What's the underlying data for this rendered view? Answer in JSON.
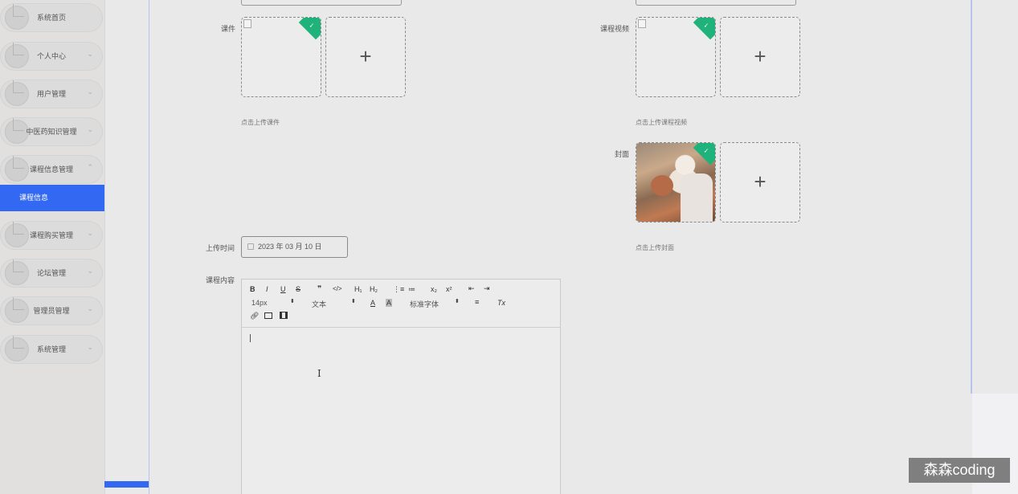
{
  "sidebar": {
    "items": [
      {
        "label": "系统首页",
        "has_arrow": false
      },
      {
        "label": "个人中心",
        "has_arrow": true
      },
      {
        "label": "用户管理",
        "has_arrow": true
      },
      {
        "label": "中医药知识管理",
        "has_arrow": true
      },
      {
        "label": "课程信息管理",
        "has_arrow": true,
        "expanded": true
      },
      {
        "label": "课程购买管理",
        "has_arrow": true
      },
      {
        "label": "论坛管理",
        "has_arrow": true
      },
      {
        "label": "管理员管理",
        "has_arrow": true
      },
      {
        "label": "系统管理",
        "has_arrow": true
      }
    ],
    "active_sub": "课程信息",
    "accent_color": "#3369f2"
  },
  "form": {
    "courseware": {
      "label": "课件",
      "hint": "点击上传课件"
    },
    "video": {
      "label": "课程视频",
      "hint": "点击上传课程视频"
    },
    "cover": {
      "label": "封面",
      "hint": "点击上传封面"
    },
    "upload_time": {
      "label": "上传时间",
      "value": "2023 年 03 月 10 日"
    },
    "content": {
      "label": "课程内容"
    },
    "add_glyph": "+"
  },
  "editor": {
    "toolbar": {
      "bold": "B",
      "italic": "I",
      "underline": "U",
      "strike": "S",
      "quote": "❞",
      "code": "</>",
      "h1": "H₁",
      "h2": "H₂",
      "ordered_list": "⋮≡",
      "bullet_list": "≔",
      "subscript": "x₂",
      "superscript": "x²",
      "outdent": "⇤",
      "indent": "⇥",
      "size": "14px",
      "format": "文本",
      "color": "A",
      "background": "A",
      "font": "标准字体",
      "align": "≡",
      "clean": "Tx"
    }
  },
  "watermark": "森森coding",
  "success_color": "#1fb27a"
}
